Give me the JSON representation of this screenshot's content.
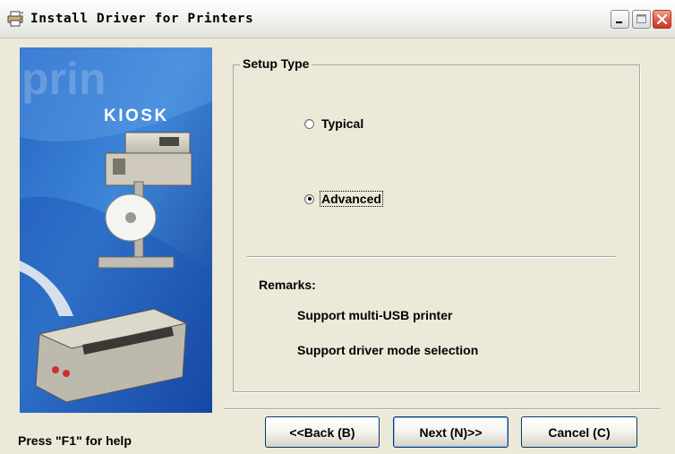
{
  "window": {
    "title": "Install Driver for Printers"
  },
  "banner": {
    "brand": "KIOSK",
    "watermark": "prin"
  },
  "setup_type": {
    "legend": "Setup Type",
    "options": [
      {
        "label": "Typical",
        "selected": false
      },
      {
        "label": "Advanced",
        "selected": true
      }
    ]
  },
  "remarks": {
    "title": "Remarks:",
    "items": [
      "Support multi-USB printer",
      "Support driver mode selection"
    ]
  },
  "footer": {
    "help": "Press \"F1\" for help"
  },
  "buttons": {
    "back": "<<Back (B)",
    "next": "Next (N)>>",
    "cancel": "Cancel (C)"
  },
  "colors": {
    "window_bg": "#ece9d8",
    "banner_blue": "#2f6fc6",
    "close_red": "#d9553f"
  }
}
